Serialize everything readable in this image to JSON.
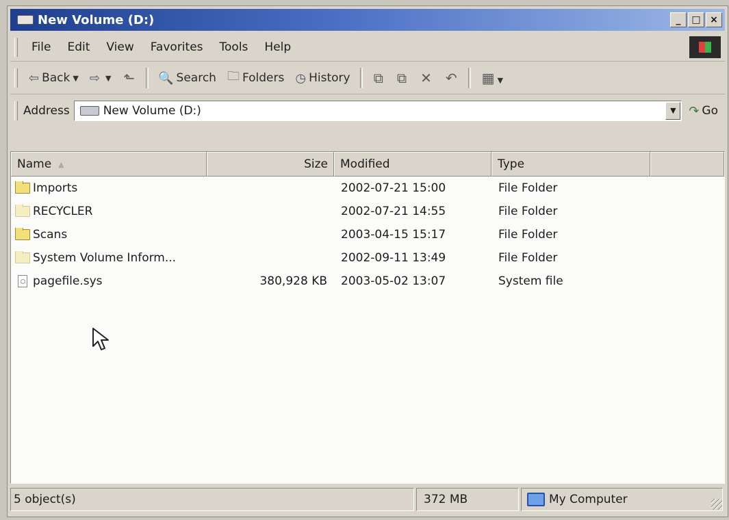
{
  "window": {
    "title": "New Volume (D:)",
    "controls": [
      "_",
      "□",
      "×"
    ]
  },
  "menubar": {
    "items": [
      "File",
      "Edit",
      "View",
      "Favorites",
      "Tools",
      "Help"
    ]
  },
  "toolbar": {
    "back": "Back",
    "search": "Search",
    "folders": "Folders",
    "history": "History"
  },
  "address": {
    "label": "Address",
    "value": "New Volume (D:)",
    "go": "Go"
  },
  "list": {
    "columns": {
      "name": "Name",
      "size": "Size",
      "modified": "Modified",
      "type": "Type"
    },
    "rows": [
      {
        "name": "Imports",
        "size": "",
        "modified": "2002-07-21 15:00",
        "type": "File Folder",
        "icon": "folder-icon"
      },
      {
        "name": "RECYCLER",
        "size": "",
        "modified": "2002-07-21 14:55",
        "type": "File Folder",
        "icon": "folder-hidden-icon"
      },
      {
        "name": "Scans",
        "size": "",
        "modified": "2003-04-15 15:17",
        "type": "File Folder",
        "icon": "folder-icon"
      },
      {
        "name": "System Volume Inform...",
        "size": "",
        "modified": "2002-09-11 13:49",
        "type": "File Folder",
        "icon": "folder-hidden-icon"
      },
      {
        "name": "pagefile.sys",
        "size": "380,928 KB",
        "modified": "2003-05-02 13:07",
        "type": "System file",
        "icon": "system-file-icon"
      }
    ]
  },
  "status": {
    "objects": "5 object(s)",
    "size": "372 MB",
    "zone": "My Computer"
  }
}
